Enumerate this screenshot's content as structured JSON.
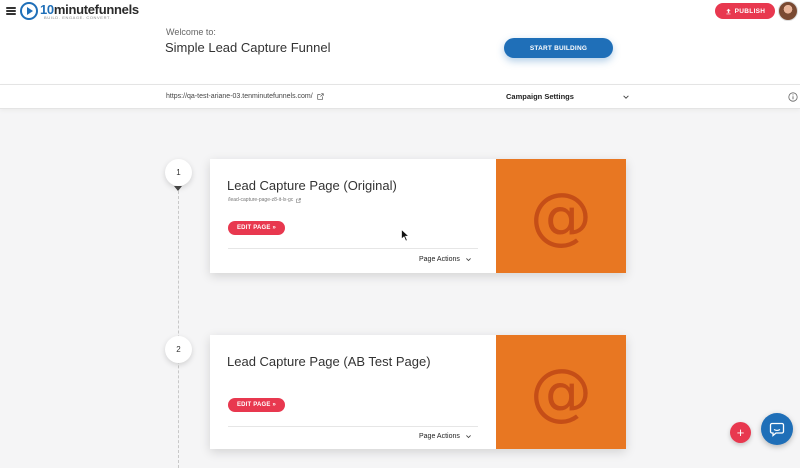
{
  "header": {
    "logo": {
      "brand_prefix": "10",
      "brand_name": "minutefunnels",
      "tagline": "BUILD. ENGAGE. CONVERT."
    },
    "publish_label": "PUBLISH",
    "welcome_label": "Welcome to:",
    "funnel_title": "Simple Lead Capture Funnel",
    "start_building_label": "START BUILDING"
  },
  "campaign_bar": {
    "url": "https://qa-test-ariane-03.tenminutefunnels.com/",
    "campaign_settings_label": "Campaign Settings"
  },
  "steps": [
    {
      "number": "1",
      "title": "Lead Capture Page (Original)",
      "path": "/lead-capture-page-z8-it-lx-gc",
      "edit_label": "EDIT PAGE »",
      "actions_label": "Page Actions",
      "thumbnail_glyph": "@"
    },
    {
      "number": "2",
      "title": "Lead Capture Page (AB Test Page)",
      "edit_label": "EDIT PAGE »",
      "actions_label": "Page Actions",
      "thumbnail_glyph": "@"
    }
  ],
  "fab": {
    "add_glyph": "+"
  },
  "colors": {
    "primary_blue": "#1f6fb8",
    "accent_red": "#e8384f",
    "thumbnail_orange": "#e87722"
  },
  "icons": [
    "menu-icon",
    "play-logo-icon",
    "upload-icon",
    "external-link-icon",
    "chevron-down-icon",
    "info-icon",
    "chat-icon",
    "plus-icon"
  ]
}
